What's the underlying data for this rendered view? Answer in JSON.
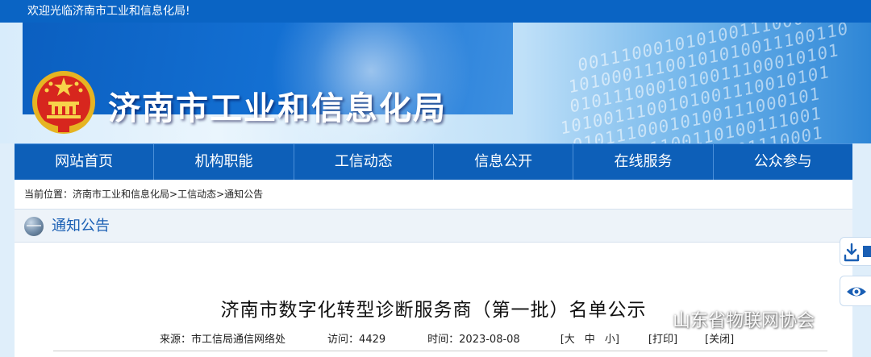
{
  "topbar": {
    "welcome": "欢迎光临济南市工业和信息化局!"
  },
  "header": {
    "site_title": "济南市工业和信息化局"
  },
  "nav": {
    "items": [
      {
        "label": "网站首页"
      },
      {
        "label": "机构职能"
      },
      {
        "label": "工信动态"
      },
      {
        "label": "信息公开"
      },
      {
        "label": "在线服务"
      },
      {
        "label": "公众参与"
      }
    ]
  },
  "breadcrumb": {
    "prefix": "当前位置：",
    "items": [
      "济南市工业和信息化局",
      "工信动态",
      "通知公告"
    ],
    "separator": ">"
  },
  "section": {
    "title": "通知公告"
  },
  "article": {
    "title": "济南市数字化转型诊断服务商（第一批）名单公示",
    "source_label": "来源：",
    "source": "市工信局通信网络处",
    "visits_label": "访问：",
    "visits": "4429",
    "time_label": "时间：",
    "date": "2023-08-08",
    "font_size_controls": [
      "[大",
      "中",
      "小]"
    ],
    "print": "[打印]",
    "close": "[关闭]"
  },
  "side_tools": {
    "download_icon": "download-icon",
    "view_icon": "eye-icon"
  },
  "watermark": {
    "text": "山东省物联网协会"
  },
  "colors": {
    "topbar": "#0a64c4",
    "nav": "#0d5fb8",
    "section_title": "#1a5fb4"
  }
}
